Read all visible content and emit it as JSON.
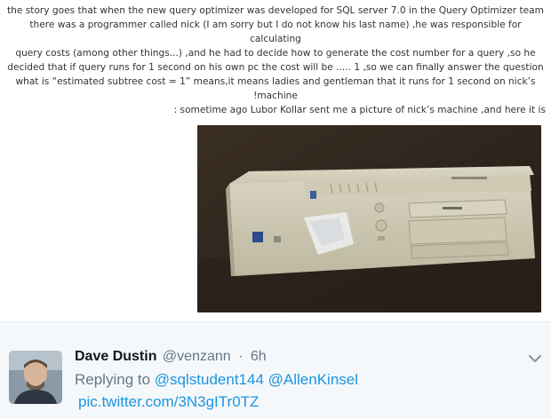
{
  "document": {
    "paragraph1_lines": [
      "the story goes that when the new query optimizer was developed for SQL server 7.0  in the Query Optimizer team",
      "there was a programmer called nick (I am sorry but I do not know his last name) ,he was responsible for calculating",
      "query costs  (among other things...)  ,and he had to decide how to generate the cost number for a query ,so he",
      "decided that if query runs for 1 second on his own pc the cost will be ..... 1 ,so we can finally answer the question",
      "what is “estimated subtree cost = 1” means,it means ladies and gentleman  that it runs for 1 second on nick’s",
      "!machine"
    ],
    "paragraph2": ": sometime ago Lubor Kollar sent me a picture of nick’s machine ,and here it is"
  },
  "tweet": {
    "name": "Dave Dustin",
    "handle": "@venzann",
    "separator": "·",
    "time": "6h",
    "replying_prefix": "Replying to",
    "mentions": [
      "@sqlstudent144",
      "@AllenKinsel"
    ],
    "pic_link": "pic.twitter.com/3N3gITr0TZ"
  },
  "colors": {
    "link": "#1b95e0",
    "muted": "#657786",
    "tweet_bg": "#f5f8fa",
    "body_text": "#333333"
  },
  "icons": {
    "caret": "chevron-down-icon",
    "avatar": "profile-photo"
  }
}
